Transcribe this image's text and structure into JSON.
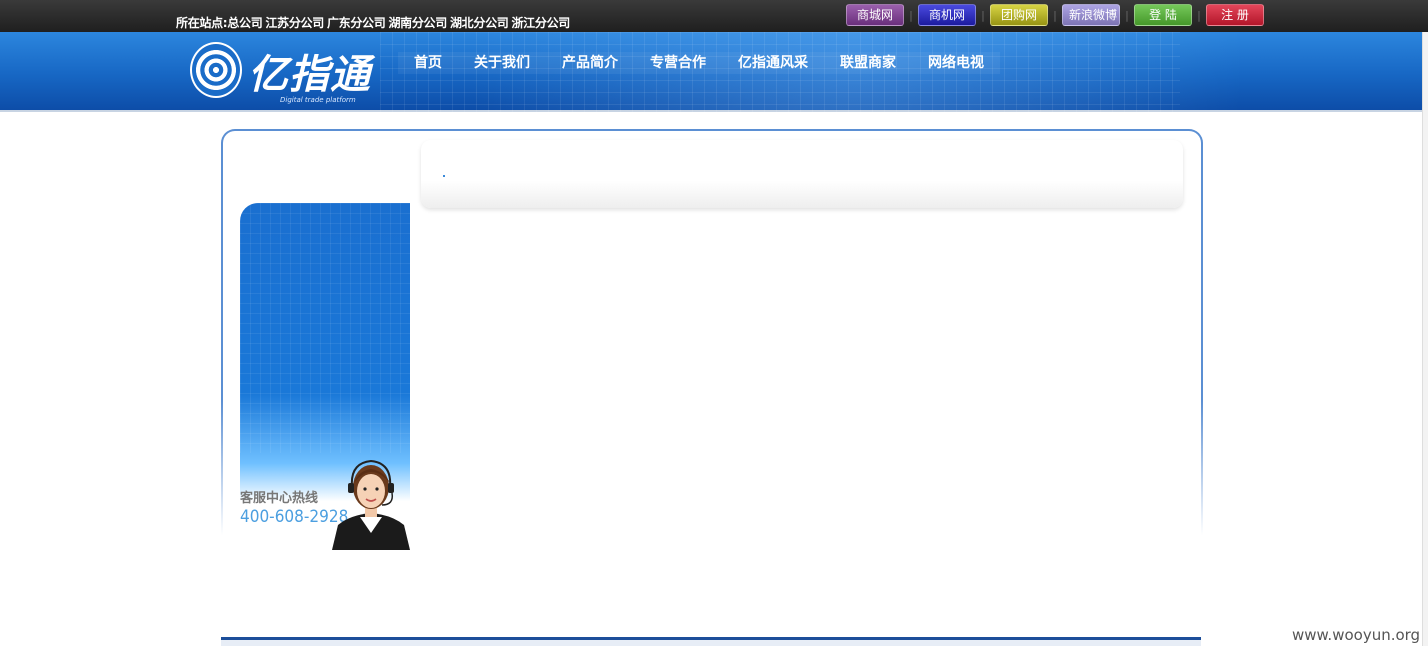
{
  "topbar": {
    "sites_label": "所在站点:",
    "sites": [
      "总公司",
      "江苏分公司",
      "广东分公司",
      "湖南分公司",
      "湖北分公司",
      "浙江分公司"
    ],
    "buttons": [
      {
        "label": "商城网",
        "color": "#7a3f8c"
      },
      {
        "label": "商机网",
        "color": "#2c2bbf"
      },
      {
        "label": "团购网",
        "color": "#b7b424"
      },
      {
        "label": "新浪微博",
        "color": "#8d84c4"
      },
      {
        "label": "登 陆",
        "color": "#55a83a"
      },
      {
        "label": "注 册",
        "color": "#c3263a"
      }
    ],
    "separator": "|"
  },
  "header": {
    "logo_text": "亿指通",
    "logo_sub": "Digital trade platform",
    "nav": [
      "首页",
      "关于我们",
      "产品简介",
      "专营合作",
      "亿指通风采",
      "联盟商家",
      "网络电视"
    ]
  },
  "sidebar": {
    "hotline_title": "客服中心热线",
    "hotline_number": "400-608-2928"
  },
  "watermark": "www.wooyun.org"
}
